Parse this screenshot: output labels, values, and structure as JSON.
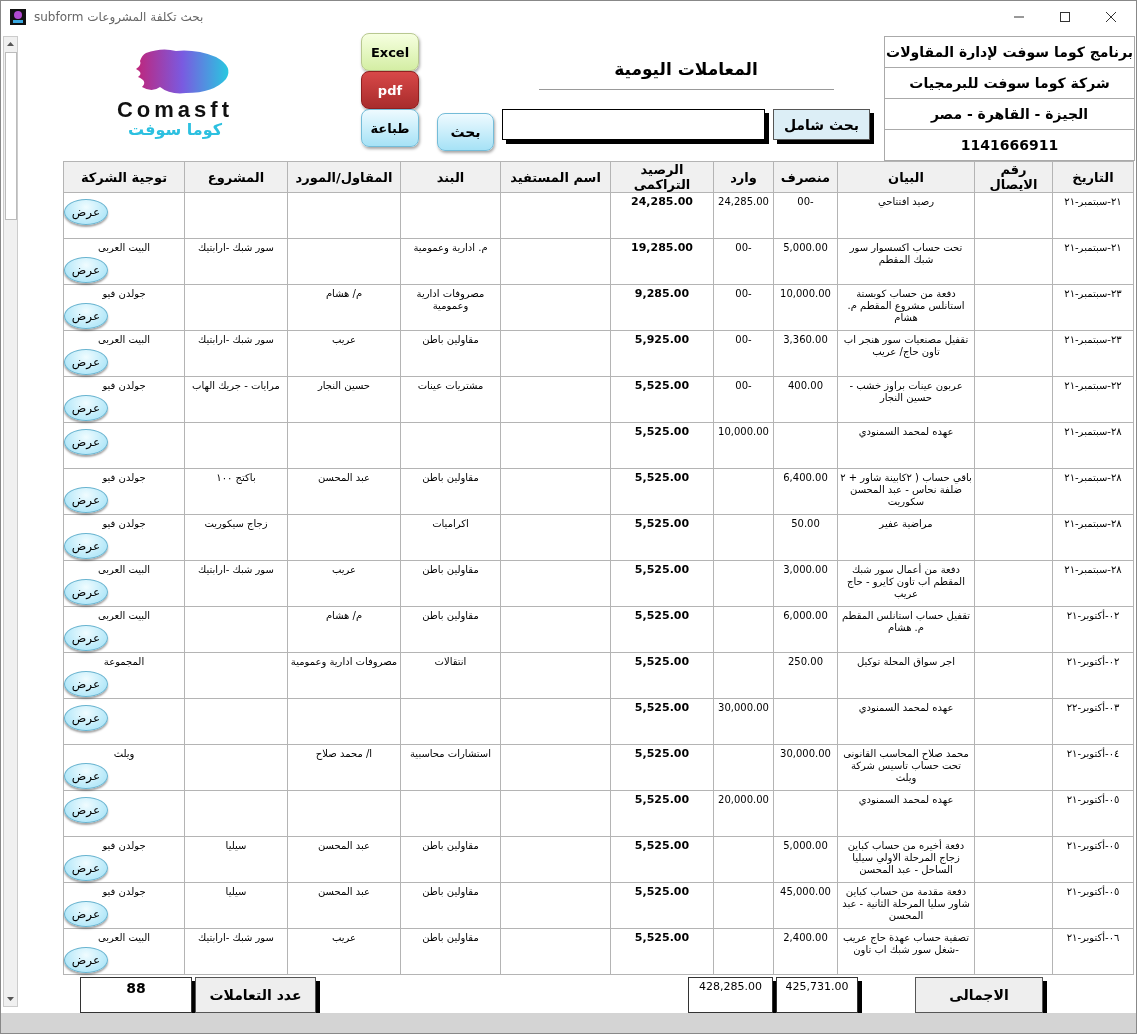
{
  "window": {
    "title": "بحث تكلفة المشروعات subform"
  },
  "logo": {
    "name": "Comasft",
    "arabic_name": "كوما سوفت"
  },
  "export_buttons": [
    {
      "label": "Excel",
      "kind": "excel"
    },
    {
      "label": "pdf",
      "kind": "pdf"
    },
    {
      "label": "طباعة",
      "kind": "print"
    }
  ],
  "search_button": "بحث",
  "page_title": "المعاملات اليومية",
  "full_search_button": "بحث شامل",
  "company_info": [
    "برنامج كوما سوفت لإدارة المقاولات",
    "شركة كوما سوفت للبرمجيات",
    "الجيزة - القاهرة - مصر",
    "1141666911"
  ],
  "table": {
    "columns": [
      {
        "label": "التاريخ"
      },
      {
        "label": "رقم الايصال"
      },
      {
        "label": "البيان"
      },
      {
        "label": "منصرف"
      },
      {
        "label": "وارد"
      },
      {
        "label": "الرصيد التراكمى"
      },
      {
        "label": "اسم المستفيد"
      },
      {
        "label": "البند"
      },
      {
        "label": "المقاول/المورد"
      },
      {
        "label": "المشروع"
      },
      {
        "label": "توجية الشركة"
      }
    ],
    "rows": [
      {
        "date": "٢١-سبتمبر-٢١",
        "description": "رصيد افتتاحي",
        "expense": "-00",
        "income": "24,285.00",
        "balance": "24,285.00",
        "action": "عرض"
      },
      {
        "date": "٢١-سبتمبر-٢١",
        "description": "تحت حساب اكسسوار سور شبك المقطم",
        "expense": "5,000.00",
        "income": "-00",
        "balance": "19,285.00",
        "item": "م. ادارية وعمومية",
        "project": "سور شبك -ارابتيك",
        "direction": "البيت العربى",
        "action": "عرض"
      },
      {
        "date": "٢٣-سبتمبر-٢١",
        "description": "دفعة من حساب كوبستة استانلس مشروع المقطم م. هشام",
        "expense": "10,000.00",
        "income": "-00",
        "balance": "9,285.00",
        "item": "مصروفات ادارية وعمومية",
        "contractor": "م/ هشام",
        "direction": "جولدن فيو",
        "action": "عرض"
      },
      {
        "date": "٢٣-سبتمبر-٢١",
        "description": "تقفيل مصنعيات سور هنجر اب تاون حاج/ عريب",
        "expense": "3,360.00",
        "income": "-00",
        "balance": "5,925.00",
        "item": "مقاولين باطن",
        "contractor": "عريب",
        "project": "سور شبك -ارابتيك",
        "direction": "البيت العربى",
        "action": "عرض"
      },
      {
        "date": "٢٢-سبتمبر-٢١",
        "description": "عربون عينات براوز خشب - حسين النجار",
        "expense": "400.00",
        "income": "-00",
        "balance": "5,525.00",
        "item": "مشتريات عينات",
        "contractor": "حسين النجار",
        "project": "مرايات - جريك الهاب",
        "direction": "جولدن فيو",
        "action": "عرض"
      },
      {
        "date": "٢٨-سبتمبر-٢١",
        "description": "عهده لمحمد السمنودي",
        "income": "10,000.00",
        "balance": "5,525.00",
        "action": "عرض"
      },
      {
        "date": "٢٨-سبتمبر-٢١",
        "description": "باقي حساب ( ٢كابينة شاور + ٢ ضلفة نحاس - عبد المحسن سكوريت",
        "expense": "6,400.00",
        "balance": "5,525.00",
        "item": "مقاولين باطن",
        "contractor": "عبد المحسن",
        "project": "باكتج ١٠٠",
        "direction": "جولدن فيو",
        "action": "عرض"
      },
      {
        "date": "٢٨-سبتمبر-٢١",
        "description": "مراضية عفير",
        "expense": "50.00",
        "balance": "5,525.00",
        "item": "اكراميات",
        "project": "زجاج سيكوريت",
        "direction": "جولدن فيو",
        "action": "عرض"
      },
      {
        "date": "٢٨-سبتمبر-٢١",
        "description": "دفعة من أعمال  سور شبك المقطم اب تاون كايرو - حاج عريب",
        "expense": "3,000.00",
        "balance": "5,525.00",
        "item": "مقاولين باطن",
        "contractor": "عريب",
        "project": "سور شبك -ارابتيك",
        "direction": "البيت العربى",
        "action": "عرض"
      },
      {
        "date": "٠٢-أكتوبر-٢١",
        "description": "تقفيل حساب استانلس المقطم م. هشام",
        "expense": "6,000.00",
        "balance": "5,525.00",
        "item": "مقاولين باطن",
        "contractor": "م/ هشام",
        "direction": "البيت العربى",
        "action": "عرض"
      },
      {
        "date": "٠٢-أكتوبر-٢١",
        "description": "اجر سواق المحلة توكيل",
        "expense": "250.00",
        "balance": "5,525.00",
        "item": "انتقالات",
        "contractor": "مصروفات ادارية وعمومية",
        "direction": "المجموعة",
        "action": "عرض"
      },
      {
        "date": "٠٣-أكتوبر-٢٢",
        "description": "عهده لمحمد السمنودي",
        "income": "30,000.00",
        "balance": "5,525.00",
        "action": "عرض"
      },
      {
        "date": "٠٤-أكتوبر-٢١",
        "description": "محمد صلاح المحاسب القانونى تحت حساب تاسيس شركة ويلث",
        "expense": "30,000.00",
        "balance": "5,525.00",
        "item": "استشارات محاسبية",
        "contractor": "ا/ محمد صلاح",
        "direction": "ويلث",
        "action": "عرض"
      },
      {
        "date": "٠٥-أكتوبر-٢١",
        "description": "عهده لمحمد السمنودي",
        "income": "20,000.00",
        "balance": "5,525.00",
        "action": "عرض"
      },
      {
        "date": "٠٥-أكتوبر-٢١",
        "description": "دفعة أخيره من حساب كباين زجاج المرحلة الاولي سيليا الساحل - عبد المحسن",
        "expense": "5,000.00",
        "balance": "5,525.00",
        "item": "مقاولين باطن",
        "contractor": "عبد المحسن",
        "project": "سيليا",
        "direction": "جولدن فيو",
        "action": "عرض"
      },
      {
        "date": "٠٥-أكتوبر-٢١",
        "description": "دفعة مقدمة من حساب كباين شاور سليا المرحلة الثانية - عبد المحسن",
        "expense": "45,000.00",
        "balance": "5,525.00",
        "item": "مقاولين باطن",
        "contractor": "عبد المحسن",
        "project": "سيليا",
        "direction": "جولدن فيو",
        "action": "عرض"
      },
      {
        "date": "٠٦-أكتوبر-٢١",
        "description": "تصفية حساب عهدة حاج عريب -شغل سور شبك اب تاون",
        "expense": "2,400.00",
        "balance": "5,525.00",
        "item": "مقاولين باطن",
        "contractor": "عريب",
        "project": "سور شبك -ارابتيك",
        "direction": "البيت العربى",
        "action": "عرض"
      }
    ]
  },
  "footer": {
    "count": "88",
    "count_label": "عدد التعاملات",
    "total_income": "428,285.00",
    "total_expense": "425,731.00",
    "total_label": "الاجمالى"
  }
}
